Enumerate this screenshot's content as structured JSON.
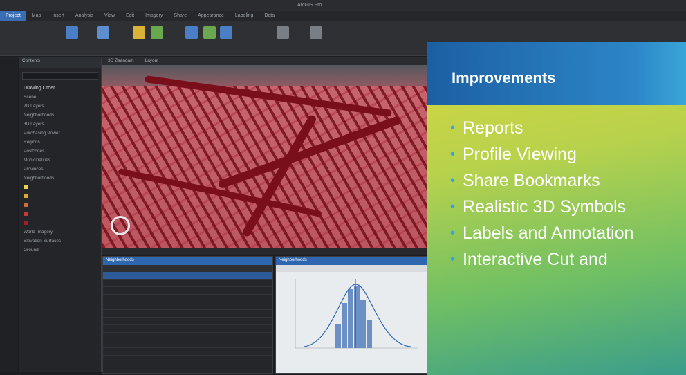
{
  "window": {
    "title": "ArcGIS Pro"
  },
  "ribbon_tabs": [
    "Project",
    "Map",
    "Insert",
    "Analysis",
    "View",
    "Edit",
    "Imagery",
    "Share",
    "Appearance",
    "Labeling",
    "Data"
  ],
  "map_tabs": [
    "3D Zaandam",
    "Layout"
  ],
  "contents": {
    "header": "Contents",
    "section": "Drawing Order",
    "layers": [
      {
        "label": "Scene",
        "color": ""
      },
      {
        "label": "2D Layers",
        "color": ""
      },
      {
        "label": "Neighborhoods",
        "color": ""
      },
      {
        "label": "3D Layers",
        "color": ""
      },
      {
        "label": "Purchasing Power",
        "color": ""
      },
      {
        "label": "Regions",
        "color": ""
      },
      {
        "label": "Postcodes",
        "color": ""
      },
      {
        "label": "Municipalities",
        "color": ""
      },
      {
        "label": "Provinces",
        "color": ""
      },
      {
        "label": "Neighborhoods",
        "color": ""
      },
      {
        "label": "",
        "color": "#e6d34a"
      },
      {
        "label": "",
        "color": "#d9a83a"
      },
      {
        "label": "",
        "color": "#cf6a3a"
      },
      {
        "label": "",
        "color": "#c23a34"
      },
      {
        "label": "",
        "color": "#9e1f2a"
      },
      {
        "label": "World Imagery",
        "color": ""
      },
      {
        "label": "Elevation Surfaces",
        "color": ""
      },
      {
        "label": "Ground",
        "color": ""
      }
    ]
  },
  "attribute_table": {
    "title": "Neighborhoods"
  },
  "chart_panel": {
    "title": "Neighborhoods"
  },
  "slide": {
    "title": "Improvements",
    "bullets": [
      "Reports",
      "Profile Viewing",
      "Share Bookmarks",
      "Realistic 3D Symbols",
      "Labels and Annotation",
      "Interactive Cut and"
    ],
    "colors": {
      "header": "#1c5fa3",
      "bullet_dot": "#3aa0e0"
    }
  }
}
